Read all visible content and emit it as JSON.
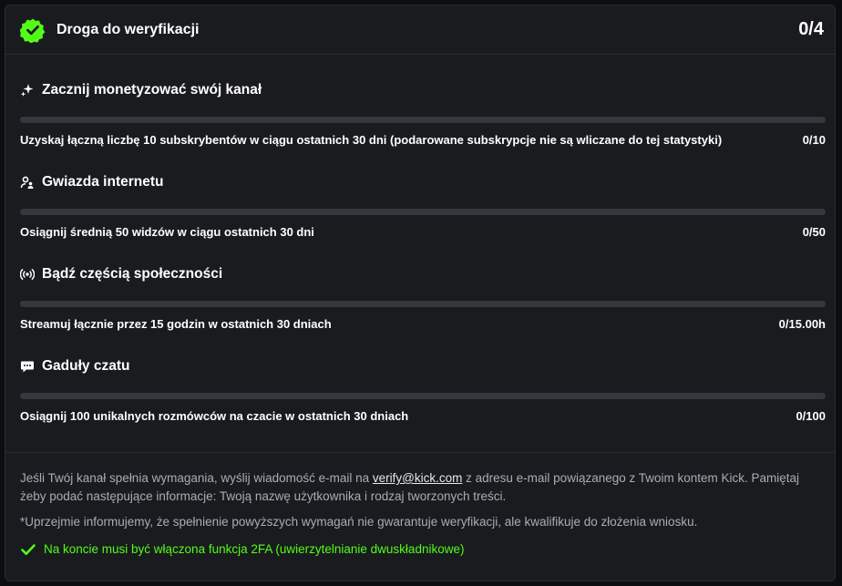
{
  "header": {
    "title": "Droga do weryfikacji",
    "count": "0/4"
  },
  "colors": {
    "accent": "#53fc18",
    "card_bg": "#191b1f",
    "bar_track": "#34373c"
  },
  "goals": [
    {
      "icon": "sparkle-icon",
      "title": "Zacznij monetyzować swój kanał",
      "description": "Uzyskaj łączną liczbę 10 subskrybentów w ciągu ostatnich 30 dni (podarowane subskrypcje nie są wliczane do tej statystyki)",
      "value": "0/10",
      "progress": 0
    },
    {
      "icon": "users-icon",
      "title": "Gwiazda internetu",
      "description": "Osiągnij średnią 50 widzów w ciągu ostatnich 30 dni",
      "value": "0/50",
      "progress": 0
    },
    {
      "icon": "broadcast-icon",
      "title": "Bądź częścią społeczności",
      "description": "Streamuj łącznie przez 15 godzin w ostatnich 30 dniach",
      "value": "0/15.00h",
      "progress": 0
    },
    {
      "icon": "chat-bubble-icon",
      "title": "Gaduły czatu",
      "description": "Osiągnij 100 unikalnych rozmówców na czacie w ostatnich 30 dniach",
      "value": "0/100",
      "progress": 0
    }
  ],
  "footer": {
    "text_before_email": "Jeśli Twój kanał spełnia wymagania, wyślij wiadomość e-mail na ",
    "email": "verify@kick.com",
    "text_after_email": " z adresu e-mail powiązanego z Twoim kontem Kick. Pamiętaj żeby podać następujące informacje: Twoją nazwę użytkownika i rodzaj tworzonych treści.",
    "disclaimer": "*Uprzejmie informujemy, że spełnienie powyższych wymagań nie gwarantuje weryfikacji, ale kwalifikuje do złożenia wniosku.",
    "twofa": "Na koncie musi być włączona funkcja 2FA (uwierzytelnianie dwuskładnikowe)"
  }
}
